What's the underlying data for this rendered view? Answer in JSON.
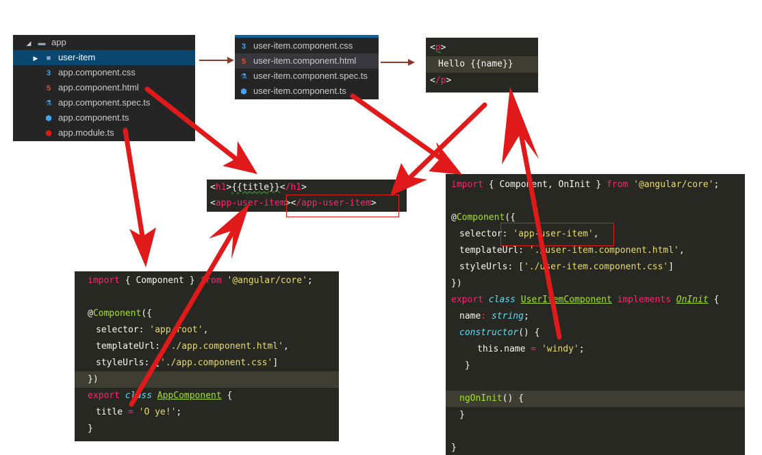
{
  "app_tree": {
    "folder": "app",
    "items": [
      {
        "label": "user-item",
        "icon": "folder-icon",
        "selected": true
      },
      {
        "label": "app.component.css",
        "icon": "css-icon"
      },
      {
        "label": "app.component.html",
        "icon": "html-icon"
      },
      {
        "label": "app.component.spec.ts",
        "icon": "flask-icon"
      },
      {
        "label": "app.component.ts",
        "icon": "angular-icon"
      },
      {
        "label": "app.module.ts",
        "icon": "angular-red-icon"
      }
    ]
  },
  "user_item_tree": {
    "items": [
      {
        "label": "user-item.component.css",
        "icon": "css-icon"
      },
      {
        "label": "user-item.component.html",
        "icon": "html-icon"
      },
      {
        "label": "user-item.component.spec.ts",
        "icon": "flask-icon"
      },
      {
        "label": "user-item.component.ts",
        "icon": "angular-icon"
      }
    ]
  },
  "user_item_html": {
    "open_tag": "p",
    "content_prefix": "Hello ",
    "interp_open": "{{",
    "interp_var": "name",
    "interp_close": "}}",
    "close_tag": "/p"
  },
  "app_html": {
    "h1_tag": "h1",
    "h1_content": "{{title}}",
    "h1_close": "/h1",
    "custom_tag": "app-user-item",
    "custom_close": "/app-user-item"
  },
  "app_ts": {
    "import_kw": "import",
    "import_names": " { Component } ",
    "from_kw": "from",
    "module": "'@angular/core'",
    "decorator": "Component",
    "selector_key": "selector",
    "selector_val": "'app-root'",
    "template_key": "templateUrl",
    "template_val": "'./app.component.html'",
    "style_key": "styleUrls",
    "style_val": "'./app.component.css'",
    "export_kw": "export",
    "class_kw": "class",
    "class_name": "AppComponent",
    "field": "title",
    "field_val": "'O ye!'"
  },
  "user_item_ts": {
    "import_names": " { Component, OnInit } ",
    "module": "'@angular/core'",
    "decorator": "Component",
    "selector_val": "'app-user-item'",
    "template_val": "'./user-item.component.html'",
    "style_val": "'./user-item.component.css'",
    "class_name": "UserItemComponent",
    "implements_kw": "implements",
    "interface": "OnInit",
    "prop": "name",
    "prop_type": "string",
    "ctor": "constructor",
    "assign_lhs": "this.name",
    "assign_val": "'windy'",
    "hook": "ngOnInit"
  },
  "colors": {
    "arrow_red": "#e01a1a",
    "arrow_brown": "#8b3a2b"
  }
}
